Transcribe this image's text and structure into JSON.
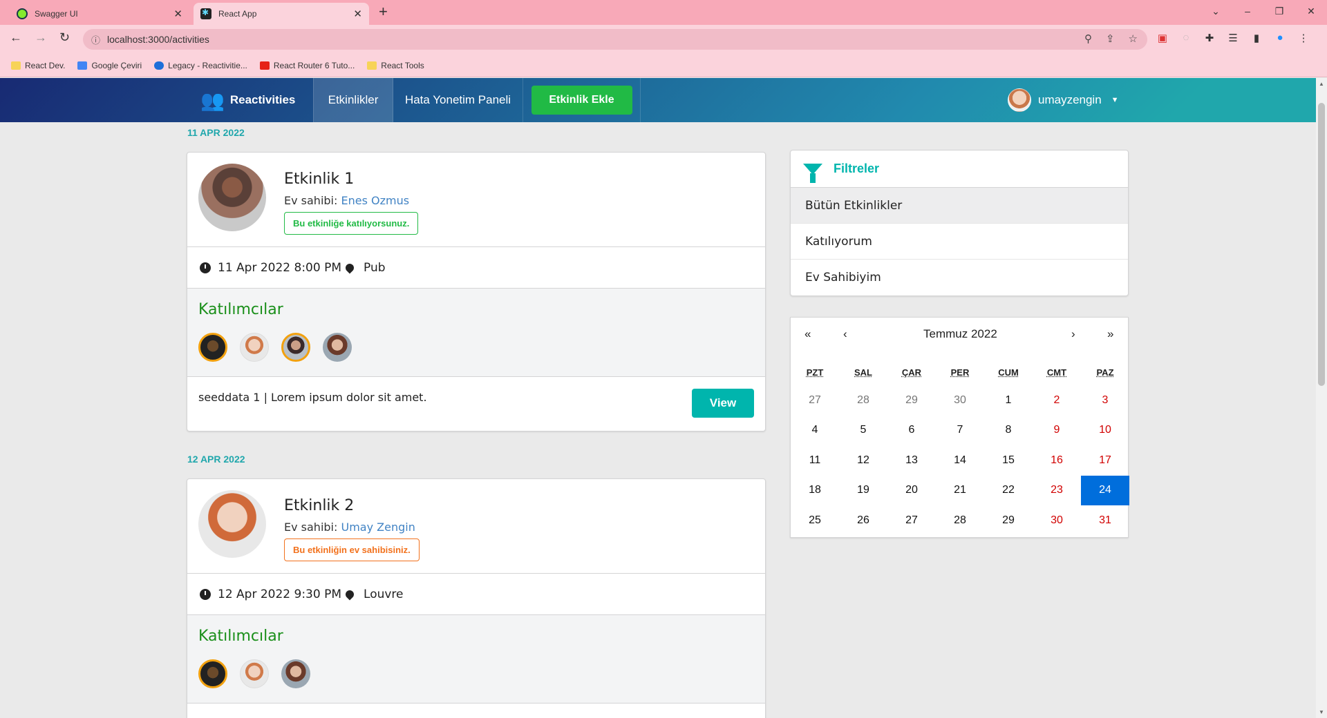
{
  "browser": {
    "tabs": [
      {
        "title": "Swagger UI",
        "active": false
      },
      {
        "title": "React App",
        "active": true
      }
    ],
    "url": "localhost:3000/activities",
    "bookmarks": [
      "React Dev.",
      "Google Çeviri",
      "Legacy - Reactivitie...",
      "React Router 6 Tuto...",
      "React Tools"
    ]
  },
  "nav": {
    "brand": "Reactivities",
    "activities": "Etkinlikler",
    "errors": "Hata Yonetim Paneli",
    "create": "Etkinlik Ekle",
    "username": "umayzengin"
  },
  "groups": [
    {
      "date": "11 APR 2022",
      "activity": {
        "title": "Etkinlik 1",
        "hosted_prefix": "Ev sahibi:",
        "host": "Enes Ozmus",
        "status": "Bu etkinliğe katılıyorsunuz.",
        "datetime": "11 Apr 2022 8:00 PM",
        "venue": "Pub",
        "attendees_title": "Katılımcılar",
        "description": "seeddata 1 | Lorem ipsum dolor sit amet.",
        "view": "View"
      }
    },
    {
      "date": "12 APR 2022",
      "activity": {
        "title": "Etkinlik 2",
        "hosted_prefix": "Ev sahibi:",
        "host": "Umay Zengin",
        "status": "Bu etkinliğin ev sahibisiniz.",
        "datetime": "12 Apr 2022 9:30 PM",
        "venue": "Louvre",
        "attendees_title": "Katılımcılar"
      }
    }
  ],
  "filters": {
    "title": "Filtreler",
    "items": [
      "Bütün Etkinlikler",
      "Katılıyorum",
      "Ev Sahibiyim"
    ]
  },
  "calendar": {
    "nav": {
      "prev2": "«",
      "prev": "‹",
      "label": "Temmuz 2022",
      "next": "›",
      "next2": "»"
    },
    "weekdays": [
      "PZT",
      "SAL",
      "ÇAR",
      "PER",
      "CUM",
      "CMT",
      "PAZ"
    ],
    "days": [
      "27",
      "28",
      "29",
      "30",
      "1",
      "2",
      "3",
      "4",
      "5",
      "6",
      "7",
      "8",
      "9",
      "10",
      "11",
      "12",
      "13",
      "14",
      "15",
      "16",
      "17",
      "18",
      "19",
      "20",
      "21",
      "22",
      "23",
      "24",
      "25",
      "26",
      "27",
      "28",
      "29",
      "30",
      "31"
    ],
    "selected": "24"
  }
}
